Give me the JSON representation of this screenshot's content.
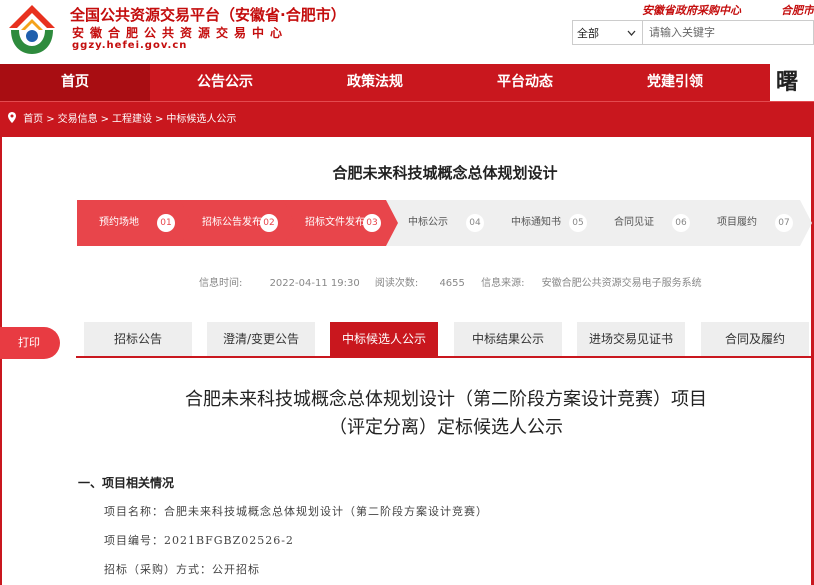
{
  "header": {
    "title": "全国公共资源交易平台（安徽省·合肥市）",
    "subtitle": "安徽合肥公共资源交易中心",
    "url": "ggzy.hefei.gov.cn",
    "links": [
      "安徽省政府采购中心",
      "合肥市"
    ],
    "search": {
      "scope": "全部",
      "placeholder": "请输入关键字"
    }
  },
  "nav": {
    "items": [
      "首页",
      "公告公示",
      "政策法规",
      "平台动态",
      "党建引领"
    ],
    "active": "首页",
    "deco": "曙"
  },
  "breadcrumb": [
    "首页",
    "交易信息",
    "工程建设",
    "中标候选人公示"
  ],
  "project_title": "合肥未来科技城概念总体规划设计",
  "steps": [
    {
      "label": "预约场地",
      "num": "01",
      "done": true
    },
    {
      "label": "招标公告发布",
      "num": "02",
      "done": true
    },
    {
      "label": "招标文件发布",
      "num": "03",
      "done": true
    },
    {
      "label": "中标公示",
      "num": "04",
      "done": false
    },
    {
      "label": "中标通知书",
      "num": "05",
      "done": false
    },
    {
      "label": "合同见证",
      "num": "06",
      "done": false
    },
    {
      "label": "项目履约",
      "num": "07",
      "done": false
    }
  ],
  "info": {
    "time_label": "信息时间:",
    "time": "2022-04-11 19:30",
    "views_label": "阅读次数:",
    "views": "4655",
    "source_label": "信息来源:",
    "source": "安徽合肥公共资源交易电子服务系统"
  },
  "print_label": "打印",
  "tabs": [
    "招标公告",
    "澄清/变更公告",
    "中标候选人公示",
    "中标结果公示",
    "进场交易见证书",
    "合同及履约"
  ],
  "active_tab": "中标候选人公示",
  "announcement": {
    "title_line1": "合肥未来科技城概念总体规划设计（第二阶段方案设计竞赛）项目",
    "title_line2": "（评定分离）定标候选人公示",
    "section1": "一、项目相关情况",
    "fields": [
      "项目名称：合肥未来科技城概念总体规划设计（第二阶段方案设计竞赛）",
      "项目编号：2021BFGBZ02526-2",
      "招标（采购）方式：公开招标"
    ]
  },
  "colors": {
    "brand_red": "#c9171e",
    "step_red": "#e8454b",
    "step_grey": "#efefef"
  }
}
